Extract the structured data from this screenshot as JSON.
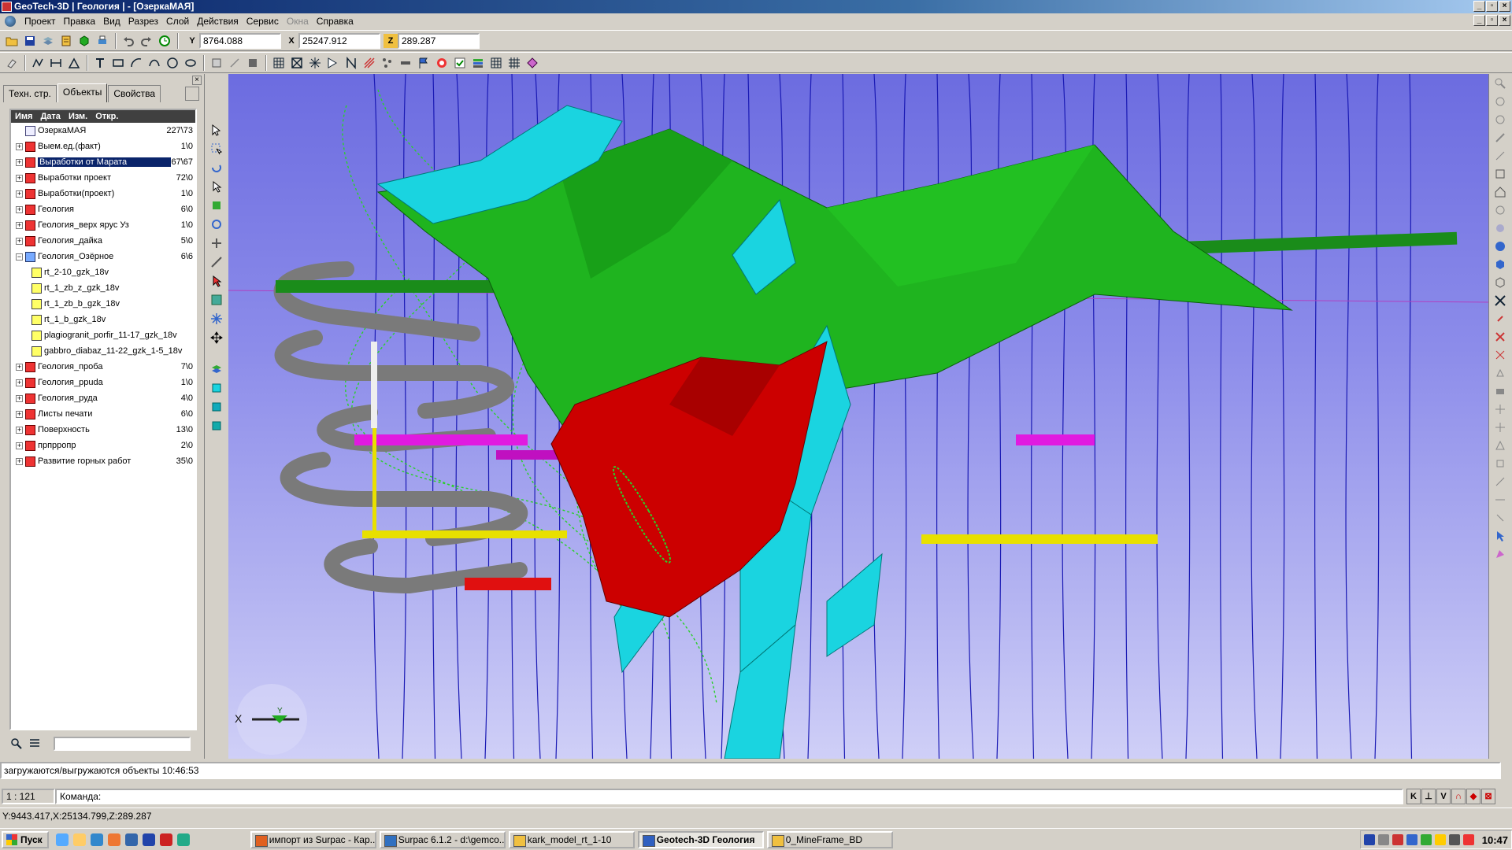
{
  "window": {
    "title": "GeoTech-3D | Геология | - [ОзеркаМАЯ]"
  },
  "menu": [
    "Проект",
    "Правка",
    "Вид",
    "Разрез",
    "Слой",
    "Действия",
    "Сервис",
    "Окна",
    "Справка"
  ],
  "menu_disabled": [
    "Окна"
  ],
  "toolbar": {
    "y_label": "Y",
    "y_value": "8764.088",
    "x_label": "X",
    "x_value": "25247.912",
    "z_label": "Z",
    "z_value": "289.287"
  },
  "panel": {
    "tabs": [
      "Техн. стр.",
      "Объекты",
      "Свойства"
    ],
    "active_tab": "Объекты",
    "columns": [
      "Имя",
      "Дата",
      "Изм.",
      "Откр."
    ],
    "root": {
      "name": "ОзеркаМАЯ",
      "count": "227\\73"
    },
    "items": [
      {
        "name": "Выем.ед.(факт)",
        "count": "1\\0",
        "expanded": false
      },
      {
        "name": "Выработки от Марата",
        "count": "67\\67",
        "expanded": false,
        "selected": true
      },
      {
        "name": "Выработки проект",
        "count": "72\\0",
        "expanded": false
      },
      {
        "name": "Выработки(проект)",
        "count": "1\\0",
        "expanded": false
      },
      {
        "name": "Геология",
        "count": "6\\0",
        "expanded": false
      },
      {
        "name": "Геология_верх ярус Уз",
        "count": "1\\0",
        "expanded": false
      },
      {
        "name": "Геология_дайка",
        "count": "5\\0",
        "expanded": false
      },
      {
        "name": "Геология_Озёрное",
        "count": "6\\6",
        "expanded": true
      },
      {
        "name": "rt_2-10_gzk_18v",
        "count": "",
        "child": true
      },
      {
        "name": "rt_1_zb_z_gzk_18v",
        "count": "",
        "child": true
      },
      {
        "name": "rt_1_zb_b_gzk_18v",
        "count": "",
        "child": true
      },
      {
        "name": "rt_1_b_gzk_18v",
        "count": "",
        "child": true
      },
      {
        "name": "plagiogranit_porfir_11-17_gzk_18v",
        "count": "",
        "child": true
      },
      {
        "name": "gabbro_diabaz_11-22_gzk_1-5_18v",
        "count": "",
        "child": true
      },
      {
        "name": "Геология_проба",
        "count": "7\\0",
        "expanded": false
      },
      {
        "name": "Геология_ррuda",
        "count": "1\\0",
        "expanded": false
      },
      {
        "name": "Геология_руда",
        "count": "4\\0",
        "expanded": false
      },
      {
        "name": "Листы печати",
        "count": "6\\0",
        "expanded": false
      },
      {
        "name": "Поверхность",
        "count": "13\\0",
        "expanded": false
      },
      {
        "name": "прпрропр",
        "count": "2\\0",
        "expanded": false
      },
      {
        "name": "Развитие горных работ",
        "count": "35\\0",
        "expanded": false
      }
    ]
  },
  "viewport": {
    "axis_x_label": "X",
    "axis_y_label": "Y",
    "background_top": "#6c6ce0",
    "background_bottom": "#cfcff7",
    "colors": {
      "green": "#1fb41f",
      "red": "#cc0000",
      "cyan": "#1ad4e0",
      "gray": "#7a7a7a",
      "yellow": "#e8e000",
      "magenta": "#e01ae0",
      "drill": "#1a1ab4"
    }
  },
  "status": {
    "message": "загружаются/выгружаются объекты 10:46:53",
    "scale": "1 : 121",
    "command_label": "Команда:",
    "cursor_coords": "Y:9443.417,X:25134.799,Z:289.287",
    "snap_buttons": [
      "K",
      "⊥",
      "V",
      "∩",
      "◆",
      "⊠"
    ]
  },
  "taskbar": {
    "start": "Пуск",
    "tasks": [
      {
        "label": "импорт из Surpac - Кар...",
        "active": false,
        "icon_color": "#e06020"
      },
      {
        "label": "Surpac 6.1.2 - d:\\gemco...",
        "active": false,
        "icon_color": "#3070c0"
      },
      {
        "label": "kark_model_rt_1-10",
        "active": false,
        "icon_color": "#f0c040"
      },
      {
        "label": "Geotech-3D Геология",
        "active": true,
        "icon_color": "#3060c0"
      },
      {
        "label": "0_MineFrame_BD",
        "active": false,
        "icon_color": "#f0c040"
      }
    ],
    "clock": "10:47"
  }
}
